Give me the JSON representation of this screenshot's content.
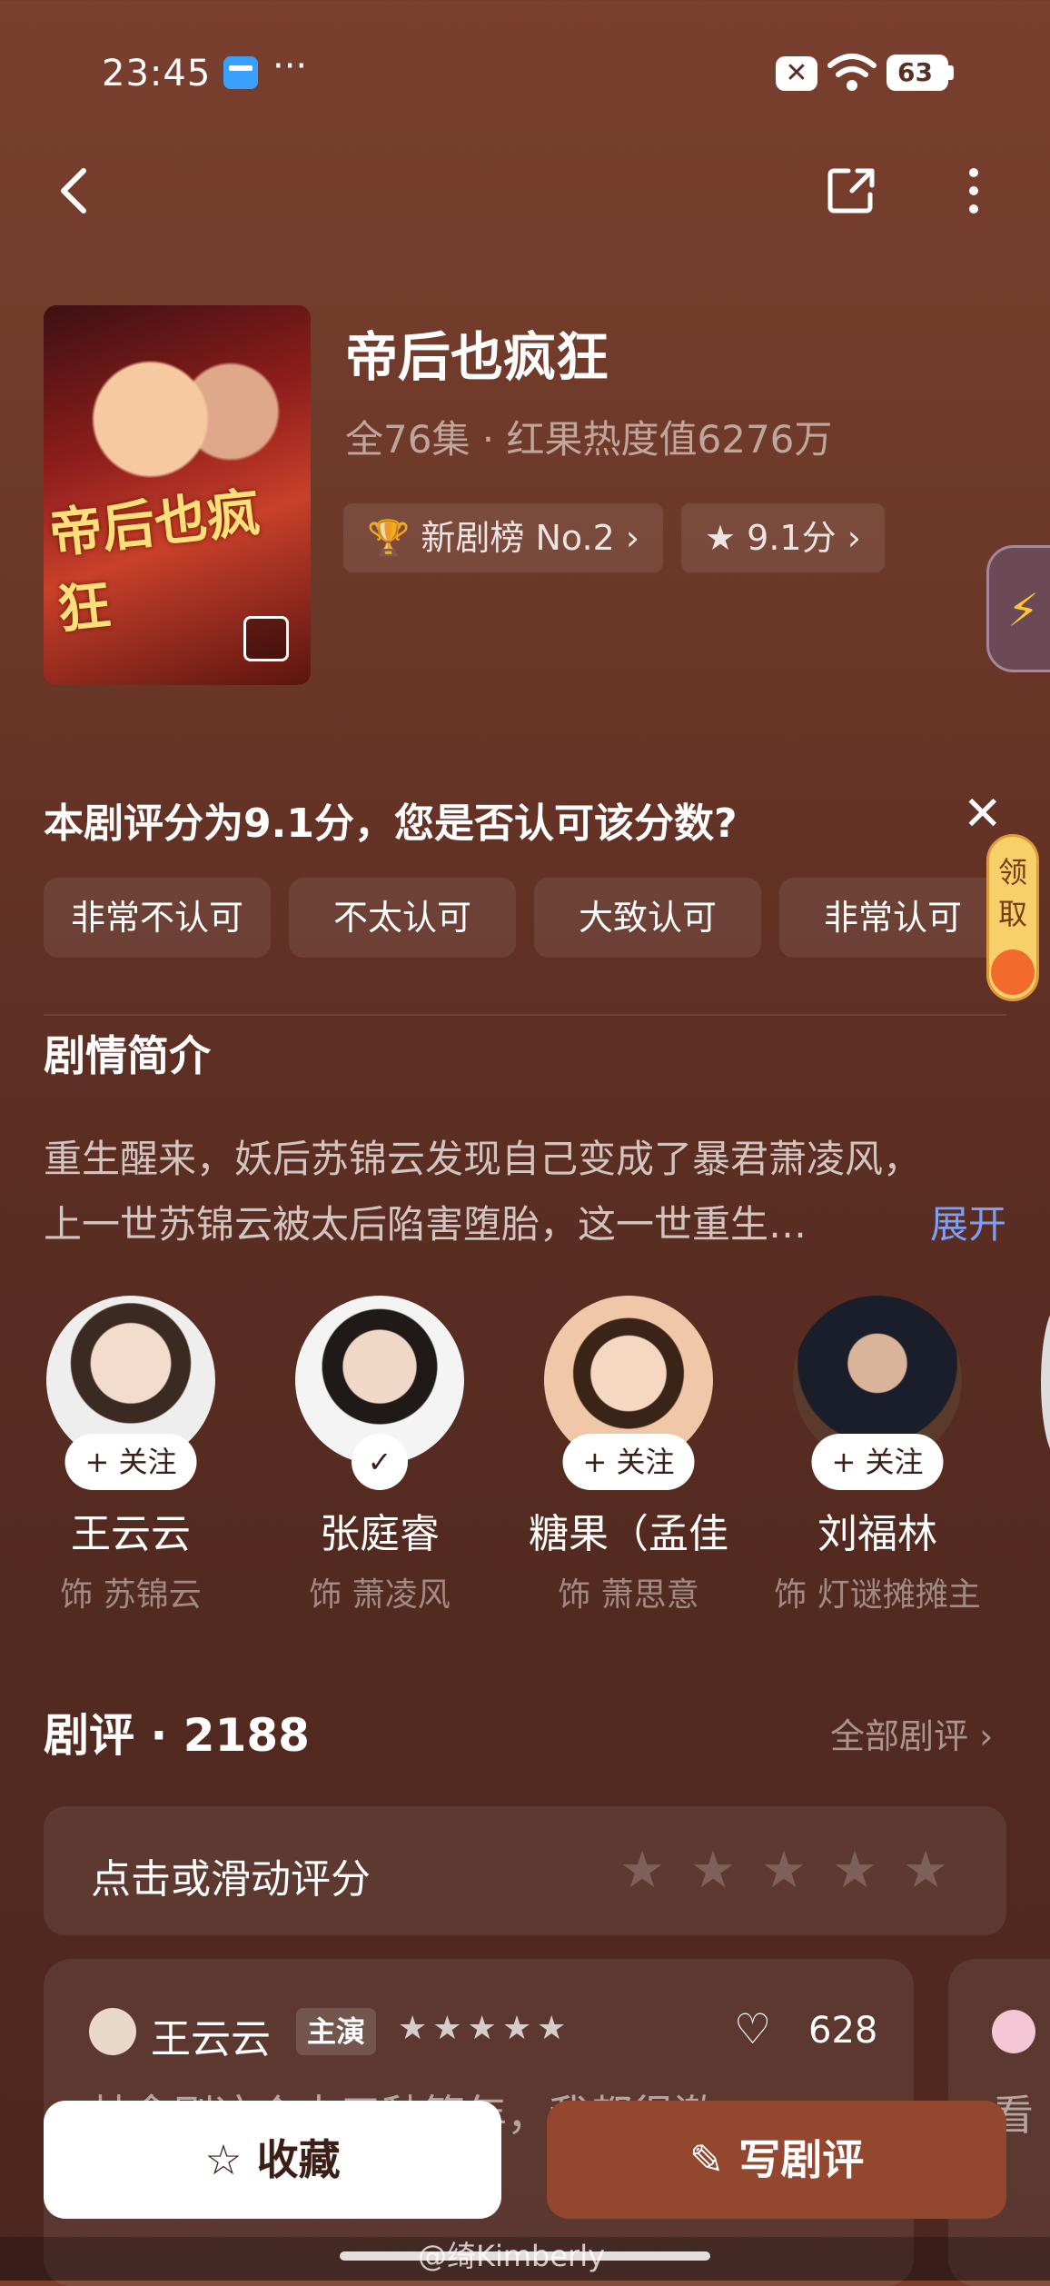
{
  "status_bar": {
    "time": "23:45",
    "dots": "···",
    "mute_glyph": "✕",
    "battery": "63"
  },
  "drama": {
    "title": "帝后也疯狂",
    "subtitle": "全76集 · 红果热度值6276万",
    "poster_title": "帝后也疯狂",
    "rank_chip": "新剧榜 No.2",
    "score_chip": "9.1分"
  },
  "rating_prompt": {
    "question": "本剧评分为9.1分，您是否认可该分数?",
    "options": [
      "非常不认可",
      "不太认可",
      "大致认可",
      "非常认可"
    ],
    "reward_text": "领取"
  },
  "synopsis": {
    "heading": "剧情简介",
    "line1": "重生醒来，妖后苏锦云发现自己变成了暴君萧凌风，",
    "line2": "上一世苏锦云被太后陷害堕胎，这一世重生…",
    "expand": "展开"
  },
  "cast": [
    {
      "name": "王云云",
      "role": "饰 苏锦云",
      "follow": "+ 关注"
    },
    {
      "name": "张庭睿",
      "role": "饰 萧凌风",
      "follow": "✓"
    },
    {
      "name": "糖果（孟佳",
      "role": "饰 萧思意",
      "follow": "+ 关注"
    },
    {
      "name": "刘福林",
      "role": "饰 灯谜摊摊主",
      "follow": "+ 关注"
    }
  ],
  "reviews": {
    "heading": "剧评 · 2188",
    "all_link": "全部剧评 ›",
    "rate_prompt": "点击或滑动评分",
    "card1": {
      "name": "王云云",
      "badge": "主演",
      "stars": "★★★★★",
      "likes": "628",
      "text": "林念刷这个太三秋等年，我都很激"
    },
    "card2": {
      "text": "看"
    }
  },
  "bottom_bar": {
    "favorite": "☆ 收藏",
    "write": "✎ 写剧评"
  },
  "watermark": "@绮Kimberly",
  "colors": {
    "background": "#6f3a2a",
    "accent_link": "#7e9ff6",
    "write_button": "#93472f",
    "bolt": "#ffc534"
  }
}
